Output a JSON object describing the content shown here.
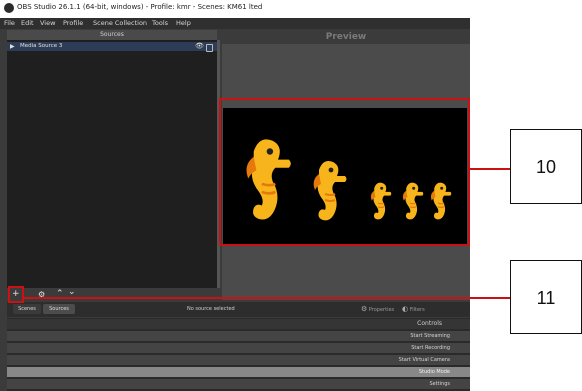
{
  "window": {
    "title": "OBS Studio 26.1.1 (64-bit, windows) - Profile: kmr - Scenes: KM61 lted"
  },
  "menu": [
    "File",
    "Edit",
    "View",
    "Profile",
    "Scene Collection",
    "Tools",
    "Help"
  ],
  "sources": {
    "header": "Sources",
    "items": [
      {
        "label": "Media Source 3"
      }
    ]
  },
  "preview": {
    "label": "Preview"
  },
  "toolbar": {
    "add": "+",
    "settings": "⚙",
    "up": "⌃",
    "down": "⌄"
  },
  "dock_tabs": {
    "scenes": "Scenes",
    "sources": "Sources"
  },
  "selection_status": "No source selected",
  "buttons": {
    "properties": "Properties",
    "filters": "Filters"
  },
  "controls": {
    "header": "Controls",
    "start_streaming": "Start Streaming",
    "start_recording": "Start Recording",
    "start_virtual_camera": "Start Virtual Camera",
    "studio_mode": "Studio Mode",
    "settings": "Settings"
  },
  "annotations": {
    "callout_10": "10",
    "callout_11": "11"
  },
  "colors": {
    "annotation_red": "#cc1111",
    "seahorse_yellow": "#f7b51b",
    "seahorse_orange": "#e6780c"
  }
}
